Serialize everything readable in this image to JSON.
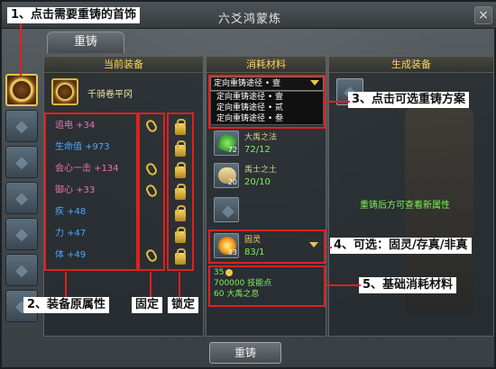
{
  "window": {
    "title": "六爻鸿蒙炼",
    "close_label": "×"
  },
  "tabs": [
    {
      "label": "重铸"
    }
  ],
  "panels": {
    "equip": {
      "header": "当前装备",
      "item_name": "千骑卷平冈",
      "attributes": [
        {
          "label": "追电 +34",
          "color": "#f070b0"
        },
        {
          "label": "生命值 +973",
          "color": "#4aa8ff"
        },
        {
          "label": "会心一击 +134",
          "color": "#f070b0"
        },
        {
          "label": "御心 +33",
          "color": "#f070b0"
        },
        {
          "label": "疾 +48",
          "color": "#4aa8ff"
        },
        {
          "label": "力 +47",
          "color": "#4aa8ff"
        },
        {
          "label": "体 +49",
          "color": "#4aa8ff"
        }
      ]
    },
    "materials": {
      "header": "消耗材料",
      "dropdown_selected": "定向重铸途径 • 壹",
      "dropdown_options": [
        "定向重铸途径 • 壹",
        "定向重铸途径 • 贰",
        "定向重铸途径 • 叁"
      ],
      "items": [
        {
          "name": "大禹之法",
          "count": "72/12",
          "stack": "72"
        },
        {
          "name": "禹士之土",
          "count": "20/10",
          "stack": "20"
        },
        {
          "name": "",
          "count": "",
          "stack": ""
        },
        {
          "name": "固灵",
          "count": "83/1",
          "stack": "83"
        }
      ],
      "cost": {
        "money": "35",
        "points": "700000 技能点",
        "extra": "60 大禹之息"
      }
    },
    "result": {
      "header": "生成装备",
      "note": "重铸后方可查看新属性"
    }
  },
  "forge_button": "重铸",
  "annotations": {
    "a1": "1、点击需要重铸的首饰",
    "a2": "2、装备原属性",
    "a2b": "固定",
    "a2c": "锁定",
    "a3": "3、点击可选重铸方案",
    "a4": "4、可选：固灵/存真/非真",
    "a5": "5、基础消耗材料"
  },
  "colors": {
    "annotation_red": "#e02020",
    "green_text": "#7ff05a",
    "header_gold": "#ffd35b"
  }
}
